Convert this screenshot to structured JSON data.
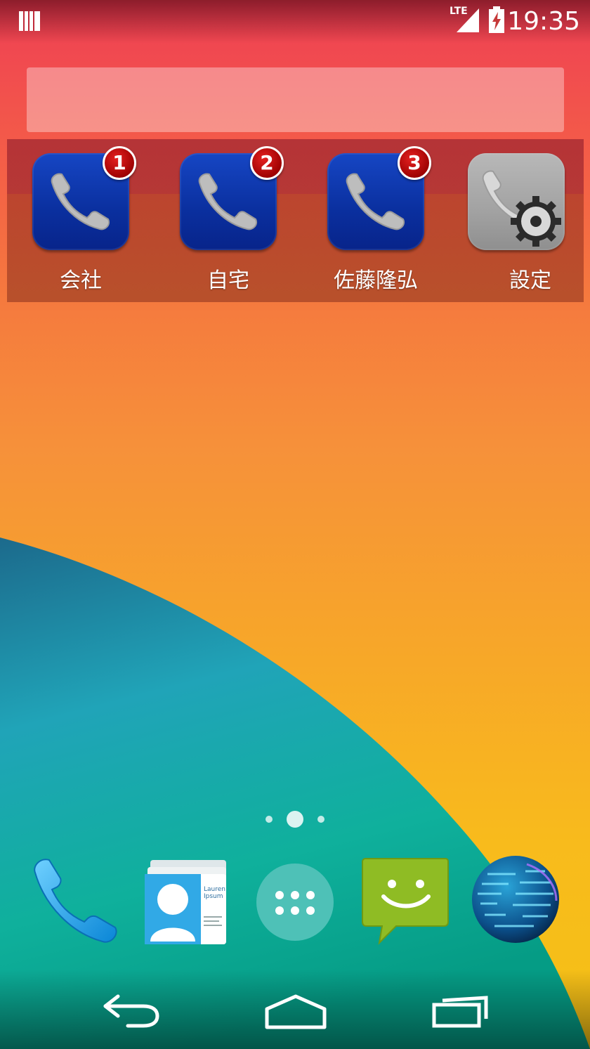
{
  "status_bar": {
    "network": "LTE",
    "time": "19:35"
  },
  "widget": {
    "items": [
      {
        "label": "会社",
        "badge": "1",
        "icon": "phone-icon"
      },
      {
        "label": "自宅",
        "badge": "2",
        "icon": "phone-icon"
      },
      {
        "label": "佐藤隆弘",
        "badge": "3",
        "icon": "phone-icon"
      },
      {
        "label": "設定",
        "icon": "phone-settings-icon"
      }
    ]
  },
  "contacts_card": {
    "name_line1": "Lauren",
    "name_line2": "Ipsum"
  },
  "dock": {
    "items": [
      "phone-app-icon",
      "contacts-app-icon",
      "app-drawer-icon",
      "messaging-app-icon",
      "browser-globe-icon"
    ]
  },
  "nav_bar": {
    "items": [
      "back-icon",
      "home-icon",
      "recents-icon"
    ]
  },
  "colors": {
    "widget_icon_blue": "#0a2f9e",
    "badge_red": "#c00000",
    "teal": "#13a9a8"
  }
}
